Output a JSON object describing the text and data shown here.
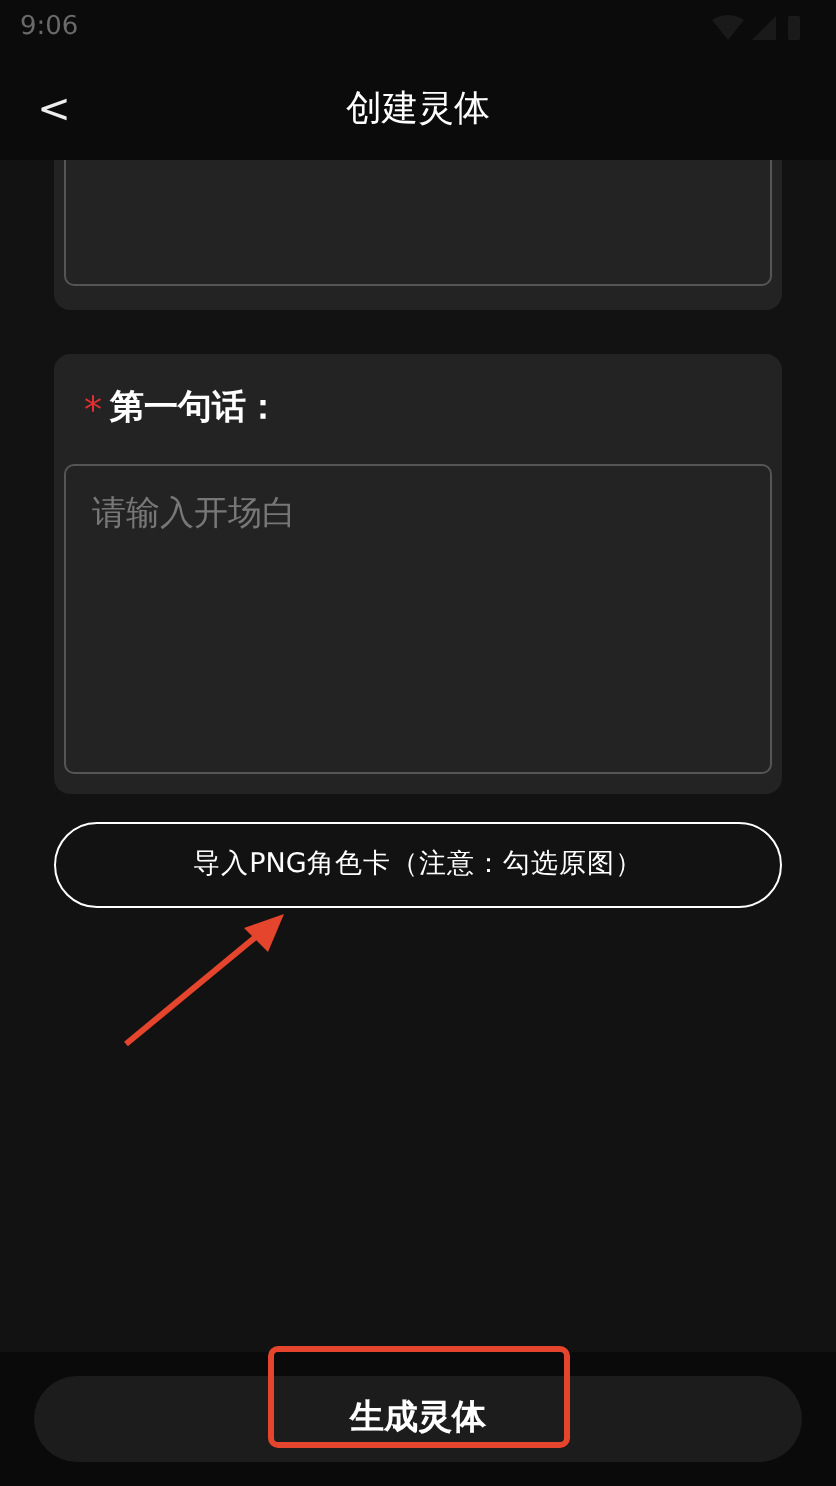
{
  "status_bar": {
    "time": "9:06"
  },
  "header": {
    "back": "<",
    "title": "创建灵体"
  },
  "cards": [
    {
      "kind": "textarea_partial"
    },
    {
      "kind": "textarea",
      "required": true,
      "required_mark": "*",
      "label": "第一句话：",
      "placeholder": "请输入开场白"
    }
  ],
  "import_button": {
    "label": "导入PNG角色卡（注意：勾选原图）"
  },
  "submit_button": {
    "label": "生成灵体"
  }
}
